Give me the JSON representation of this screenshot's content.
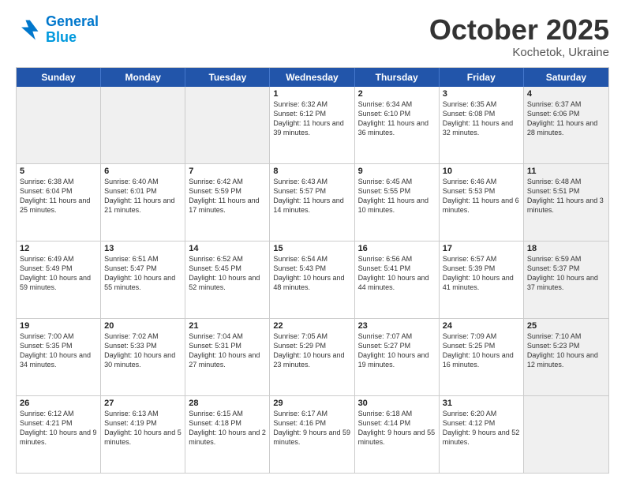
{
  "header": {
    "logo_line1": "General",
    "logo_line2": "Blue",
    "month": "October 2025",
    "location": "Kochetok, Ukraine"
  },
  "days_of_week": [
    "Sunday",
    "Monday",
    "Tuesday",
    "Wednesday",
    "Thursday",
    "Friday",
    "Saturday"
  ],
  "weeks": [
    [
      {
        "day": "",
        "text": "",
        "shaded": true,
        "empty": true
      },
      {
        "day": "",
        "text": "",
        "shaded": true,
        "empty": true
      },
      {
        "day": "",
        "text": "",
        "shaded": true,
        "empty": true
      },
      {
        "day": "1",
        "text": "Sunrise: 6:32 AM\nSunset: 6:12 PM\nDaylight: 11 hours\nand 39 minutes.",
        "shaded": false
      },
      {
        "day": "2",
        "text": "Sunrise: 6:34 AM\nSunset: 6:10 PM\nDaylight: 11 hours\nand 36 minutes.",
        "shaded": false
      },
      {
        "day": "3",
        "text": "Sunrise: 6:35 AM\nSunset: 6:08 PM\nDaylight: 11 hours\nand 32 minutes.",
        "shaded": false
      },
      {
        "day": "4",
        "text": "Sunrise: 6:37 AM\nSunset: 6:06 PM\nDaylight: 11 hours\nand 28 minutes.",
        "shaded": true
      }
    ],
    [
      {
        "day": "5",
        "text": "Sunrise: 6:38 AM\nSunset: 6:04 PM\nDaylight: 11 hours\nand 25 minutes.",
        "shaded": false
      },
      {
        "day": "6",
        "text": "Sunrise: 6:40 AM\nSunset: 6:01 PM\nDaylight: 11 hours\nand 21 minutes.",
        "shaded": false
      },
      {
        "day": "7",
        "text": "Sunrise: 6:42 AM\nSunset: 5:59 PM\nDaylight: 11 hours\nand 17 minutes.",
        "shaded": false
      },
      {
        "day": "8",
        "text": "Sunrise: 6:43 AM\nSunset: 5:57 PM\nDaylight: 11 hours\nand 14 minutes.",
        "shaded": false
      },
      {
        "day": "9",
        "text": "Sunrise: 6:45 AM\nSunset: 5:55 PM\nDaylight: 11 hours\nand 10 minutes.",
        "shaded": false
      },
      {
        "day": "10",
        "text": "Sunrise: 6:46 AM\nSunset: 5:53 PM\nDaylight: 11 hours\nand 6 minutes.",
        "shaded": false
      },
      {
        "day": "11",
        "text": "Sunrise: 6:48 AM\nSunset: 5:51 PM\nDaylight: 11 hours\nand 3 minutes.",
        "shaded": true
      }
    ],
    [
      {
        "day": "12",
        "text": "Sunrise: 6:49 AM\nSunset: 5:49 PM\nDaylight: 10 hours\nand 59 minutes.",
        "shaded": false
      },
      {
        "day": "13",
        "text": "Sunrise: 6:51 AM\nSunset: 5:47 PM\nDaylight: 10 hours\nand 55 minutes.",
        "shaded": false
      },
      {
        "day": "14",
        "text": "Sunrise: 6:52 AM\nSunset: 5:45 PM\nDaylight: 10 hours\nand 52 minutes.",
        "shaded": false
      },
      {
        "day": "15",
        "text": "Sunrise: 6:54 AM\nSunset: 5:43 PM\nDaylight: 10 hours\nand 48 minutes.",
        "shaded": false
      },
      {
        "day": "16",
        "text": "Sunrise: 6:56 AM\nSunset: 5:41 PM\nDaylight: 10 hours\nand 44 minutes.",
        "shaded": false
      },
      {
        "day": "17",
        "text": "Sunrise: 6:57 AM\nSunset: 5:39 PM\nDaylight: 10 hours\nand 41 minutes.",
        "shaded": false
      },
      {
        "day": "18",
        "text": "Sunrise: 6:59 AM\nSunset: 5:37 PM\nDaylight: 10 hours\nand 37 minutes.",
        "shaded": true
      }
    ],
    [
      {
        "day": "19",
        "text": "Sunrise: 7:00 AM\nSunset: 5:35 PM\nDaylight: 10 hours\nand 34 minutes.",
        "shaded": false
      },
      {
        "day": "20",
        "text": "Sunrise: 7:02 AM\nSunset: 5:33 PM\nDaylight: 10 hours\nand 30 minutes.",
        "shaded": false
      },
      {
        "day": "21",
        "text": "Sunrise: 7:04 AM\nSunset: 5:31 PM\nDaylight: 10 hours\nand 27 minutes.",
        "shaded": false
      },
      {
        "day": "22",
        "text": "Sunrise: 7:05 AM\nSunset: 5:29 PM\nDaylight: 10 hours\nand 23 minutes.",
        "shaded": false
      },
      {
        "day": "23",
        "text": "Sunrise: 7:07 AM\nSunset: 5:27 PM\nDaylight: 10 hours\nand 19 minutes.",
        "shaded": false
      },
      {
        "day": "24",
        "text": "Sunrise: 7:09 AM\nSunset: 5:25 PM\nDaylight: 10 hours\nand 16 minutes.",
        "shaded": false
      },
      {
        "day": "25",
        "text": "Sunrise: 7:10 AM\nSunset: 5:23 PM\nDaylight: 10 hours\nand 12 minutes.",
        "shaded": true
      }
    ],
    [
      {
        "day": "26",
        "text": "Sunrise: 6:12 AM\nSunset: 4:21 PM\nDaylight: 10 hours\nand 9 minutes.",
        "shaded": false
      },
      {
        "day": "27",
        "text": "Sunrise: 6:13 AM\nSunset: 4:19 PM\nDaylight: 10 hours\nand 5 minutes.",
        "shaded": false
      },
      {
        "day": "28",
        "text": "Sunrise: 6:15 AM\nSunset: 4:18 PM\nDaylight: 10 hours\nand 2 minutes.",
        "shaded": false
      },
      {
        "day": "29",
        "text": "Sunrise: 6:17 AM\nSunset: 4:16 PM\nDaylight: 9 hours\nand 59 minutes.",
        "shaded": false
      },
      {
        "day": "30",
        "text": "Sunrise: 6:18 AM\nSunset: 4:14 PM\nDaylight: 9 hours\nand 55 minutes.",
        "shaded": false
      },
      {
        "day": "31",
        "text": "Sunrise: 6:20 AM\nSunset: 4:12 PM\nDaylight: 9 hours\nand 52 minutes.",
        "shaded": false
      },
      {
        "day": "",
        "text": "",
        "shaded": true,
        "empty": true
      }
    ]
  ]
}
